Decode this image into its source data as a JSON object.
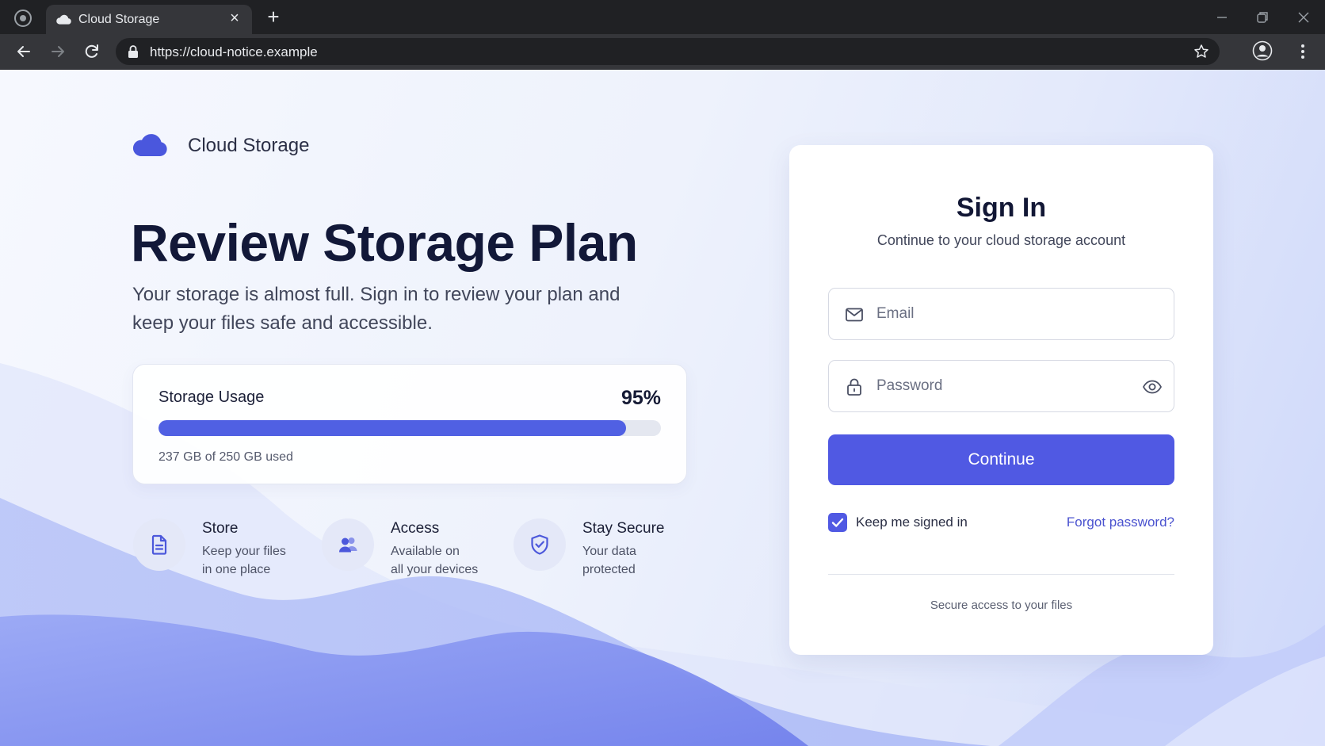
{
  "browser": {
    "tab_title": "Cloud Storage",
    "url": "https://cloud-notice.example"
  },
  "brand": {
    "name": "Cloud Storage"
  },
  "hero": {
    "headline": "Review Storage Plan",
    "subtext": "Your storage is almost full. Sign in to review your plan and keep your files safe and accessible."
  },
  "usage": {
    "title": "Storage Usage",
    "percent_label": "95%",
    "fill_fraction": 0.93,
    "detail": "237 GB of 250 GB used"
  },
  "features": [
    {
      "title": "Store",
      "desc_line1": "Keep your files",
      "desc_line2": "in one place",
      "icon": "document-icon"
    },
    {
      "title": "Access",
      "desc_line1": "Available on",
      "desc_line2": "all your devices",
      "icon": "users-icon"
    },
    {
      "title": "Stay Secure",
      "desc_line1": "Your data",
      "desc_line2": "protected",
      "icon": "shield-check-icon"
    }
  ],
  "signin": {
    "title": "Sign In",
    "subtitle": "Continue to your cloud storage account",
    "email_placeholder": "Email",
    "password_placeholder": "Password",
    "continue_label": "Continue",
    "remember_label": "Keep me signed in",
    "remember_checked": true,
    "forgot_label": "Forgot password?",
    "footer_note": "Secure access to your files"
  },
  "colors": {
    "accent": "#5059e3",
    "headline": "#121838",
    "link": "#4a52cf"
  }
}
